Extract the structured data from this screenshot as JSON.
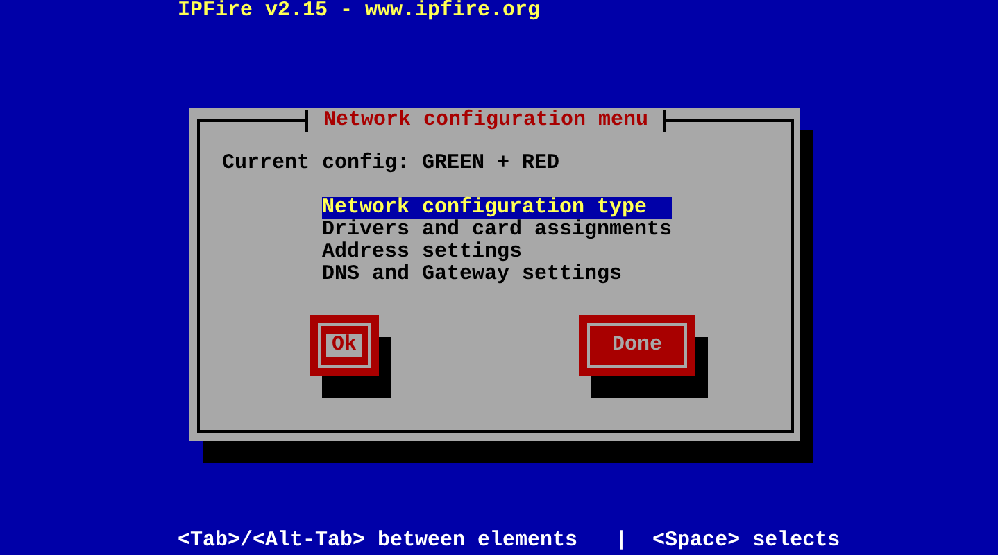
{
  "header": "IPFire v2.15 - www.ipfire.org",
  "dialog": {
    "title": "Network configuration menu",
    "current_config": "Current config: GREEN + RED",
    "menu": [
      {
        "label": "Network configuration type",
        "selected": true
      },
      {
        "label": "Drivers and card assignments",
        "selected": false
      },
      {
        "label": "Address settings",
        "selected": false
      },
      {
        "label": "DNS and Gateway settings",
        "selected": false
      }
    ],
    "buttons": [
      {
        "label": "Ok",
        "focused": true
      },
      {
        "label": "Done",
        "focused": false
      }
    ]
  },
  "status_bar": "<Tab>/<Alt-Tab> between elements   |  <Space> selects"
}
